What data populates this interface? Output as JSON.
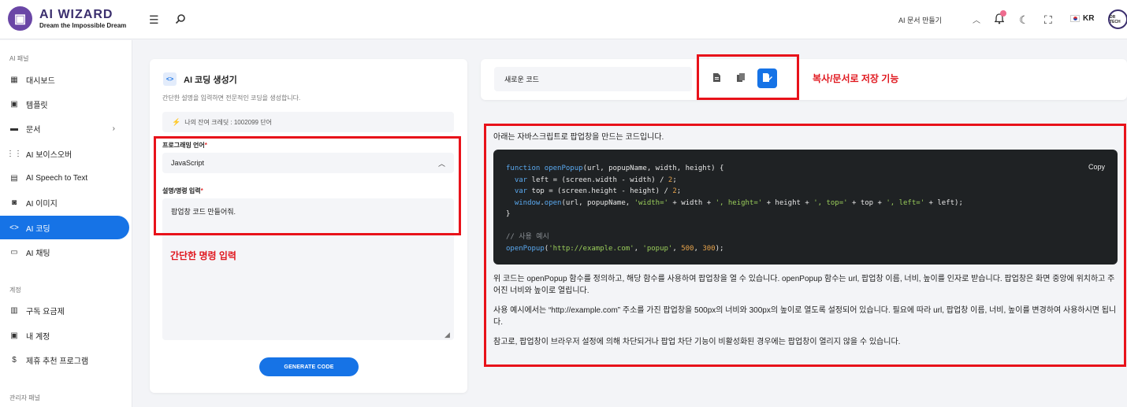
{
  "header": {
    "brand_title": "AI WIZARD",
    "brand_subtitle": "Dream the Impossible Dream",
    "template_select": "AI 문서 만들기",
    "language": "KR",
    "avatar_label": "DR TECH"
  },
  "sidebar": {
    "section_ai": "AI 패널",
    "section_account": "계정",
    "section_admin": "관리자 패널",
    "items": [
      {
        "label": "대시보드",
        "icon": "dashboard-icon"
      },
      {
        "label": "템플릿",
        "icon": "template-icon"
      },
      {
        "label": "문서",
        "icon": "folder-icon"
      },
      {
        "label": "AI 보이스오버",
        "icon": "waveform-icon"
      },
      {
        "label": "AI Speech to Text",
        "icon": "speech-to-text-icon"
      },
      {
        "label": "AI 이미지",
        "icon": "image-icon"
      },
      {
        "label": "AI 코딩",
        "icon": "code-icon"
      },
      {
        "label": "AI 채팅",
        "icon": "chat-icon"
      }
    ],
    "account_items": [
      {
        "label": "구독 요금제",
        "icon": "subscription-icon"
      },
      {
        "label": "내 계정",
        "icon": "account-icon"
      },
      {
        "label": "제휴 추천 프로그램",
        "icon": "dollar-icon"
      }
    ],
    "active_item": "AI 코딩"
  },
  "generator": {
    "title": "AI 코딩 생성기",
    "description": "간단한 설명을 입력하면 전문적인 코딩을 생성합니다.",
    "credits": "나의 잔여 크레딧 : 1002099 단어",
    "language_label": "프로그래밍 언어",
    "language_value": "JavaScript",
    "prompt_label": "설명/명령 입력",
    "prompt_value": "팝업창 코드 만들어줘.",
    "generate_button": "GENERATE CODE",
    "required_mark": "*"
  },
  "toolbar": {
    "document_name": "새로운 코드"
  },
  "result": {
    "intro": "아래는 자바스크립트로 팝업창을 만드는 코드입니다.",
    "copy_label": "Copy",
    "paragraph1": "위 코드는 openPopup 함수를 정의하고, 해당 함수를 사용하여 팝업창을 열 수 있습니다. openPopup 함수는 url, 팝업창 이름, 너비, 높이를 인자로 받습니다. 팝업창은 화면 중앙에 위치하고 주어진 너비와 높이로 열립니다.",
    "paragraph2": "사용 예시에서는 “http://example.com” 주소를 가진 팝업창을 500px의 너비와 300px의 높이로 열도록 설정되어 있습니다. 필요에 따라 url, 팝업창 이름, 너비, 높이를 변경하여 사용하시면 됩니다.",
    "paragraph3": "참고로, 팝업창이 브라우저 설정에 의해 차단되거나 팝업 차단 기능이 비활성화된 경우에는 팝업창이 열리지 않을 수 있습니다."
  },
  "annotations": {
    "save_copy": "복사/문서로 저장 기능",
    "simple_prompt": "간단한 명령 입력"
  },
  "colors": {
    "accent": "#1673e6",
    "annotation_red": "#e8121a",
    "brand": "#6a46a6"
  }
}
